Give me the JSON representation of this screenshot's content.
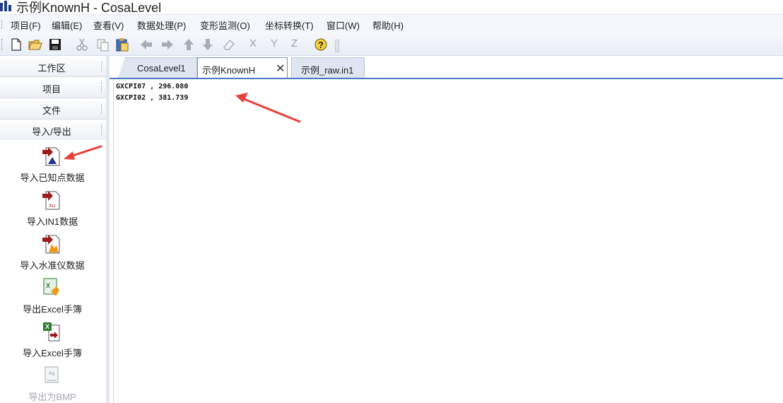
{
  "window": {
    "title": "示例KnownH - CosaLevel"
  },
  "menu": {
    "items": [
      "项目(F)",
      "编辑(E)",
      "查看(V)",
      "数据处理(P)",
      "变形监测(O)",
      "坐标转换(T)",
      "窗口(W)",
      "帮助(H)"
    ]
  },
  "toolbar": {
    "icons": [
      "new-file-icon",
      "open-folder-icon",
      "save-icon",
      "cut-icon",
      "copy-icon",
      "paste-icon",
      "arrow-left-icon",
      "arrow-right-icon",
      "arrow-up-icon",
      "arrow-down-icon",
      "eraser-icon",
      "help-icon"
    ],
    "axis_buttons": [
      "X",
      "Y",
      "Z"
    ]
  },
  "sidebar": {
    "sections": [
      "工作区",
      "项目",
      "文件",
      "导入/导出"
    ],
    "commands": [
      {
        "label": "导入已知点数据",
        "icon": "import-known-points-icon",
        "enabled": true
      },
      {
        "label": "导入IN1数据",
        "icon": "import-in1-icon",
        "enabled": true
      },
      {
        "label": "导入水准仪数据",
        "icon": "import-level-icon",
        "enabled": true
      },
      {
        "label": "导出Excel手簿",
        "icon": "export-excel-icon",
        "enabled": true
      },
      {
        "label": "导入Excel手簿",
        "icon": "import-excel-icon",
        "enabled": true
      },
      {
        "label": "导出为BMP",
        "icon": "export-bmp-icon",
        "enabled": false
      }
    ]
  },
  "tabs": [
    {
      "label": "CosaLevel1",
      "active": false
    },
    {
      "label": "示例KnownH",
      "active": true
    },
    {
      "label": "示例_raw.in1",
      "active": false
    }
  ],
  "editor": {
    "lines": [
      "GXCPI07 , 296.080",
      "GXCPI02 , 381.739"
    ]
  },
  "colors": {
    "accent": "#4a78c0",
    "annotation_arrow": "#e8413a"
  }
}
